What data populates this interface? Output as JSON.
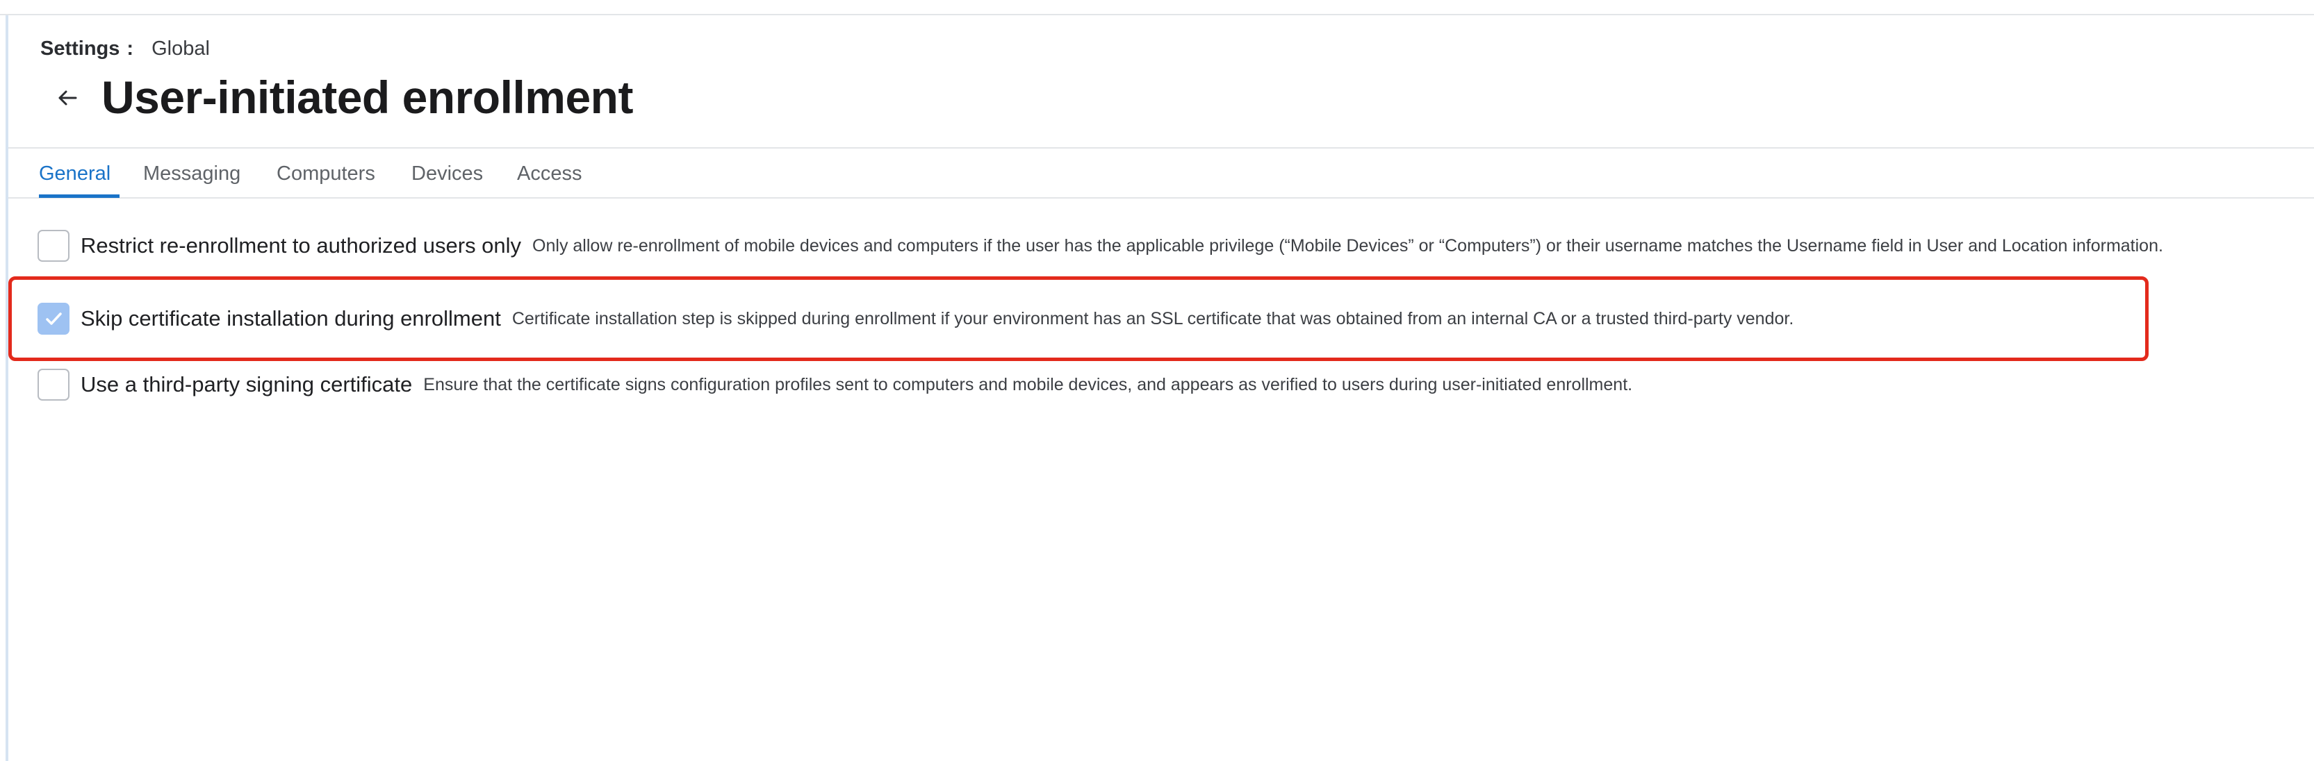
{
  "breadcrumb": {
    "root": "Settings",
    "separator": ":",
    "current": "Global"
  },
  "header": {
    "back_icon": "arrow-left-icon",
    "title": "User-initiated enrollment"
  },
  "tabs": [
    {
      "label": "General",
      "active": true
    },
    {
      "label": "Messaging",
      "active": false
    },
    {
      "label": "Computers",
      "active": false
    },
    {
      "label": "Devices",
      "active": false
    },
    {
      "label": "Access",
      "active": false
    }
  ],
  "settings": [
    {
      "label": "Restrict re-enrollment to authorized users only",
      "description": "Only allow re-enrollment of mobile devices and computers if the user has the applicable privilege (“Mobile Devices” or “Computers”) or their username matches the Username field in User and Location information.",
      "checked": false
    },
    {
      "label": "Skip certificate installation during enrollment",
      "description": "Certificate installation step is skipped during enrollment if your environment has an SSL certificate that was obtained from an internal CA or a trusted third-party vendor.",
      "checked": true,
      "highlighted": true
    },
    {
      "label": "Use a third-party signing certificate",
      "description": "Ensure that the certificate signs configuration profiles sent to computers and mobile devices, and appears as verified to users during user-initiated enrollment.",
      "checked": false
    }
  ],
  "colors": {
    "accent": "#1a73c8",
    "checkbox_checked": "#9ec2f2",
    "highlight": "#e32a1c"
  }
}
